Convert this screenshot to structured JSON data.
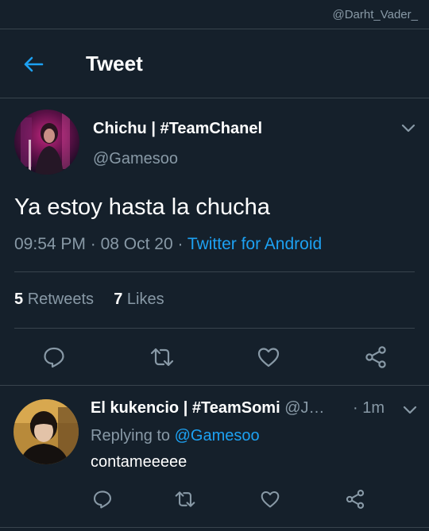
{
  "watermark": "@Darht_Vader_",
  "header": {
    "title": "Tweet"
  },
  "tweet": {
    "author_name": "Chichu | #TeamChanel",
    "author_handle": "@Gamesoo",
    "text": "Ya estoy hasta la chucha",
    "time": "09:54 PM",
    "date": "08 Oct 20",
    "source": "Twitter for Android",
    "retweets_count": "5",
    "retweets_label": "Retweets",
    "likes_count": "7",
    "likes_label": "Likes"
  },
  "reply": {
    "author_name": "El kukencio | #TeamSomi",
    "author_handle": "@J…",
    "time": "· 1m",
    "replying_prefix": "Replying to",
    "replying_to": "@Gamesoo",
    "text": "contameeeee"
  },
  "colors": {
    "background": "#15202b",
    "border": "#38444d",
    "secondary_text": "#8899a6",
    "accent": "#1da1f2"
  },
  "icons": [
    "back-arrow-icon",
    "chevron-down-icon",
    "reply-icon",
    "retweet-icon",
    "like-icon",
    "share-icon"
  ]
}
